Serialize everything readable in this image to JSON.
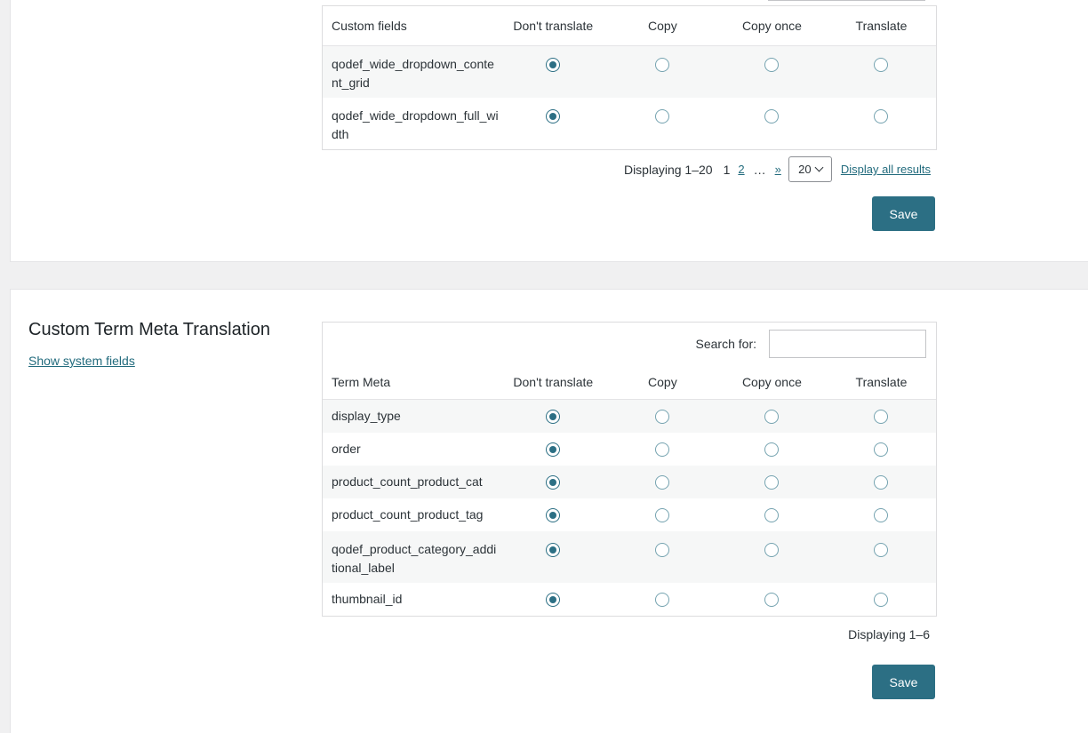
{
  "custom_fields_section": {
    "columns": {
      "name": "Custom fields",
      "dont_translate": "Don't translate",
      "copy": "Copy",
      "copy_once": "Copy once",
      "translate": "Translate"
    },
    "rows": [
      {
        "name": "qodef_wide_dropdown_content_grid",
        "selected": "dont_translate"
      },
      {
        "name": "qodef_wide_dropdown_full_width",
        "selected": "dont_translate"
      }
    ],
    "pager": {
      "displaying": "Displaying 1–20",
      "current_page": "1",
      "page_2": "2",
      "ellipsis": "…",
      "next": "»",
      "per_page": "20",
      "display_all": "Display all results"
    },
    "save_label": "Save"
  },
  "term_meta_section": {
    "title": "Custom Term Meta Translation",
    "show_system_fields": "Show system fields",
    "search_label": "Search for:",
    "search_value": "",
    "columns": {
      "name": "Term Meta",
      "dont_translate": "Don't translate",
      "copy": "Copy",
      "copy_once": "Copy once",
      "translate": "Translate"
    },
    "rows": [
      {
        "name": "display_type",
        "selected": "dont_translate"
      },
      {
        "name": "order",
        "selected": "dont_translate"
      },
      {
        "name": "product_count_product_cat",
        "selected": "dont_translate"
      },
      {
        "name": "product_count_product_tag",
        "selected": "dont_translate"
      },
      {
        "name": "qodef_product_category_additional_label",
        "selected": "dont_translate"
      },
      {
        "name": "thumbnail_id",
        "selected": "dont_translate"
      }
    ],
    "displaying": "Displaying 1–6",
    "save_label": "Save"
  },
  "colors": {
    "accent": "#2c6f84",
    "link": "#226b7d",
    "background": "#f0f0f1"
  }
}
